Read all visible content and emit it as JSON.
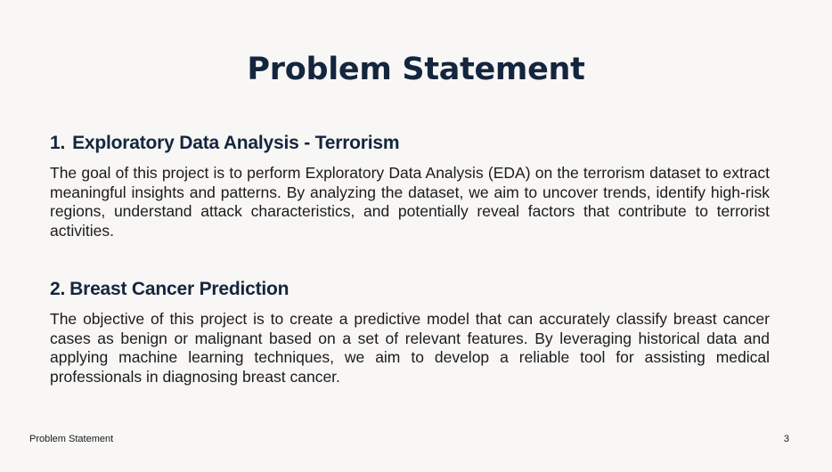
{
  "slide": {
    "title": "Problem Statement"
  },
  "sections": [
    {
      "number": "1.",
      "heading": "Exploratory Data Analysis - Terrorism",
      "body": "The goal of this project is to perform Exploratory Data Analysis (EDA) on the terrorism dataset to extract meaningful insights and patterns. By analyzing the dataset, we aim to uncover trends, identify high-risk regions, understand attack characteristics, and potentially reveal factors that contribute to terrorist activities."
    },
    {
      "number": "2.",
      "heading": "Breast Cancer Prediction",
      "body": "The objective of this project is to create a predictive model that can accurately classify breast cancer cases as benign or malignant based on a set of relevant features. By leveraging historical data and applying machine learning techniques, we aim to develop a reliable tool for assisting medical professionals in diagnosing breast cancer."
    }
  ],
  "footer": {
    "label": "Problem Statement",
    "page_number": "3"
  }
}
